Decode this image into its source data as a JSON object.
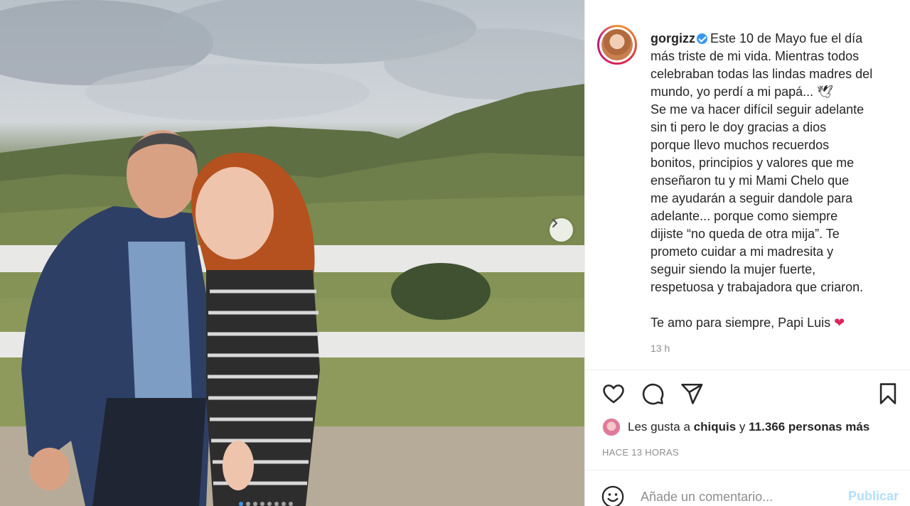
{
  "post": {
    "username": "gorgizz",
    "caption_lines": [
      "Este 10 de Mayo fue el día",
      "más triste de mi vida. Mientras todos",
      "celebraban todas las lindas madres del",
      "mundo, yo perdí a mi papá... 🕊",
      "Se me va hacer difícil seguir adelante",
      "sin ti pero le doy gracias a dios",
      "porque llevo muchos recuerdos",
      "bonitos, principios y valores que me",
      "enseñaron tu y mi Mami Chelo que",
      "me ayudarán a seguir dandole para",
      "adelante... porque como siempre",
      "dijiste “no queda de otra mija”. Te",
      "prometo cuidar a mi madresita y",
      "seguir siendo la mujer fuerte,",
      "respetuosa y trabajadora que criaron."
    ],
    "closing_line": "Te amo para siempre, Papi Luis",
    "closing_emoji": "❤",
    "time_ago": "13 h"
  },
  "likes": {
    "prefix": "Les gusta a",
    "user": "chiquis",
    "joiner": "y",
    "others": "11.366 personas más"
  },
  "post_date": "HACE 13 HORAS",
  "comment": {
    "placeholder": "Añade un comentario...",
    "publish_label": "Publicar"
  },
  "icons": {
    "like": "heart-icon",
    "comment": "comment-icon",
    "share": "share-icon",
    "save": "bookmark-icon",
    "emoji": "smile-icon",
    "next": "chevron-right-icon",
    "verified": "verified-badge-icon"
  },
  "colors": {
    "accent": "#3897f0",
    "heart": "#e0245e",
    "publish_disabled": "#b2dffc",
    "muted": "#8e8e8e",
    "text": "#262626"
  },
  "carousel": {
    "slide_count": 8,
    "active_index": 1
  }
}
